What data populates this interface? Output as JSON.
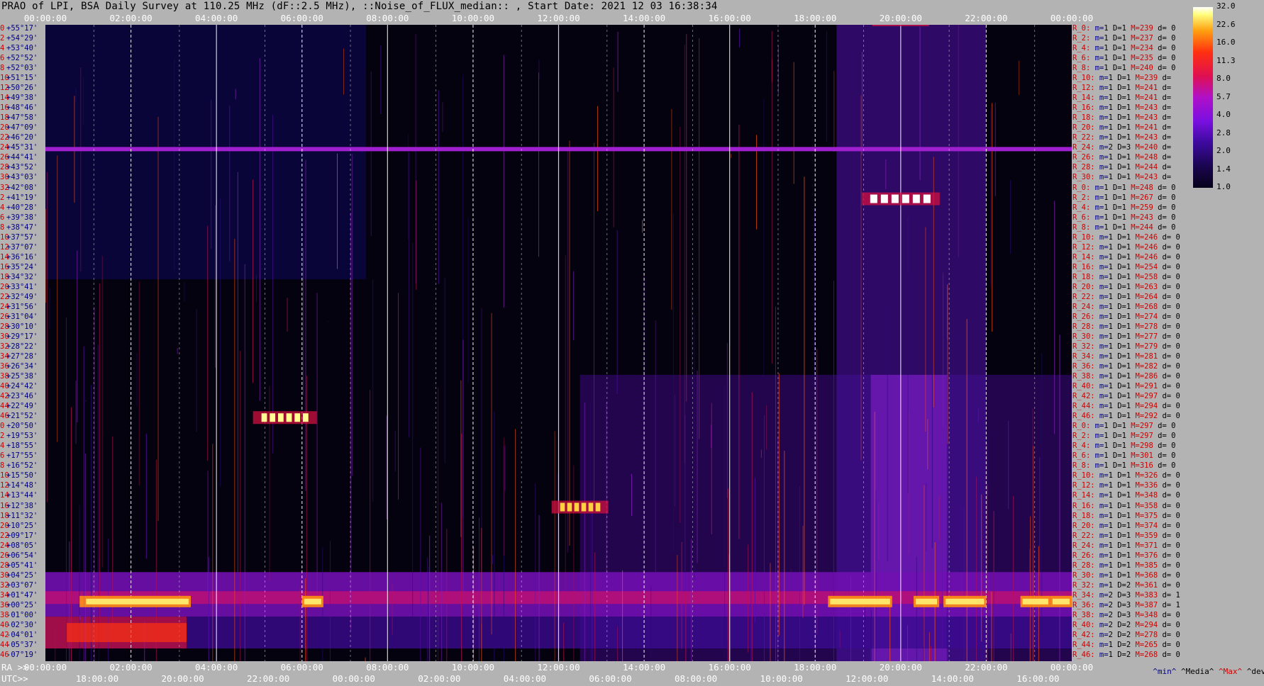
{
  "title": "PRAO of LPI, BSA Daily Survey at 110.25 MHz (dF::2.5 MHz), ::Noise_of_FLUX_median:: , Start Date: 2021 12 03 16:38:34",
  "top_ticks": [
    "00:00:00",
    "02:00:00",
    "04:00:00",
    "06:00:00",
    "08:00:00",
    "10:00:00",
    "12:00:00",
    "14:00:00",
    "16:00:00",
    "18:00:00",
    "20:00:00",
    "22:00:00",
    "00:00:00"
  ],
  "bottom": {
    "ra_label": "RA >>",
    "utc_label": "UTC>>",
    "ra_ticks": [
      "00:00:00",
      "02:00:00",
      "04:00:00",
      "06:00:00",
      "08:00:00",
      "10:00:00",
      "12:00:00",
      "14:00:00",
      "16:00:00",
      "18:00:00",
      "20:00:00",
      "22:00:00",
      "00:00:00"
    ],
    "utc_ticks": [
      "18:00:00",
      "20:00:00",
      "22:00:00",
      "00:00:00",
      "02:00:00",
      "04:00:00",
      "06:00:00",
      "08:00:00",
      "10:00:00",
      "12:00:00",
      "14:00:00",
      "16:00:00"
    ]
  },
  "legend": {
    "min": "^min^",
    "median": "^Media^",
    "max": "^Max^",
    "dev": "^devia"
  },
  "colorbar": {
    "ticks": [
      "32.0",
      "22.6",
      "16.0",
      "11.3",
      "8.0",
      "5.7",
      "4.0",
      "2.8",
      "2.0",
      "1.4",
      "1.0"
    ]
  },
  "colors": {
    "background": "#b3b3b3",
    "plot": "#05020f",
    "red": "#d00000",
    "navy": "#000080"
  },
  "declinations": [
    {
      "n": "0",
      "d": "+55°17'"
    },
    {
      "n": "2",
      "d": "+54°29'"
    },
    {
      "n": "4",
      "d": "+53°40'"
    },
    {
      "n": "6",
      "d": "+52°52'"
    },
    {
      "n": "8",
      "d": "+52°03'"
    },
    {
      "n": "10",
      "d": "+51°15'"
    },
    {
      "n": "12",
      "d": "+50°26'"
    },
    {
      "n": "14",
      "d": "+49°38'"
    },
    {
      "n": "16",
      "d": "+48°46'"
    },
    {
      "n": "18",
      "d": "+47°58'"
    },
    {
      "n": "20",
      "d": "+47°09'"
    },
    {
      "n": "22",
      "d": "+46°20'"
    },
    {
      "n": "24",
      "d": "+45°31'"
    },
    {
      "n": "26",
      "d": "+44°41'"
    },
    {
      "n": "28",
      "d": "+43°52'"
    },
    {
      "n": "30",
      "d": "+43°03'"
    },
    {
      "n": "32",
      "d": "+42°08'"
    },
    {
      "n": "2",
      "d": "+41°19'"
    },
    {
      "n": "4",
      "d": "+40°28'"
    },
    {
      "n": "6",
      "d": "+39°38'"
    },
    {
      "n": "8",
      "d": "+38°47'"
    },
    {
      "n": "10",
      "d": "+37°57'"
    },
    {
      "n": "12",
      "d": "+37°07'"
    },
    {
      "n": "14",
      "d": "+36°16'"
    },
    {
      "n": "16",
      "d": "+35°24'"
    },
    {
      "n": "18",
      "d": "+34°32'"
    },
    {
      "n": "20",
      "d": "+33°41'"
    },
    {
      "n": "22",
      "d": "+32°49'"
    },
    {
      "n": "24",
      "d": "+31°56'"
    },
    {
      "n": "26",
      "d": "+31°04'"
    },
    {
      "n": "28",
      "d": "+30°10'"
    },
    {
      "n": "30",
      "d": "+29°17'"
    },
    {
      "n": "32",
      "d": "+28°22'"
    },
    {
      "n": "34",
      "d": "+27°28'"
    },
    {
      "n": "36",
      "d": "+26°34'"
    },
    {
      "n": "38",
      "d": "+25°38'"
    },
    {
      "n": "40",
      "d": "+24°42'"
    },
    {
      "n": "42",
      "d": "+23°46'"
    },
    {
      "n": "44",
      "d": "+22°49'"
    },
    {
      "n": "46",
      "d": "+21°52'"
    },
    {
      "n": "0",
      "d": "+20°50'"
    },
    {
      "n": "2",
      "d": "+19°53'"
    },
    {
      "n": "4",
      "d": "+18°55'"
    },
    {
      "n": "6",
      "d": "+17°55'"
    },
    {
      "n": "8",
      "d": "+16°52'"
    },
    {
      "n": "10",
      "d": "+15°50'"
    },
    {
      "n": "12",
      "d": "+14°48'"
    },
    {
      "n": "14",
      "d": "+13°44'"
    },
    {
      "n": "16",
      "d": "+12°38'"
    },
    {
      "n": "18",
      "d": "+11°32'"
    },
    {
      "n": "20",
      "d": "+10°25'"
    },
    {
      "n": "22",
      "d": "+09°17'"
    },
    {
      "n": "24",
      "d": "+08°05'"
    },
    {
      "n": "26",
      "d": "+06°54'"
    },
    {
      "n": "28",
      "d": "+05°41'"
    },
    {
      "n": "30",
      "d": "+04°25'"
    },
    {
      "n": "32",
      "d": "+03°07'"
    },
    {
      "n": "34",
      "d": "+01°47'"
    },
    {
      "n": "36",
      "d": "+00°25'"
    },
    {
      "n": "38",
      "d": "-01°00'"
    },
    {
      "n": "40",
      "d": "-02°30'"
    },
    {
      "n": "42",
      "d": "-04°01'"
    },
    {
      "n": "44",
      "d": "-05°37'"
    },
    {
      "n": "46",
      "d": "-07°19'"
    }
  ],
  "right_labels": [
    {
      "ra": "R_0:",
      "m": "1",
      "D": "1",
      "M": "239",
      "d": "0"
    },
    {
      "ra": "R_2:",
      "m": "1",
      "D": "1",
      "M": "237",
      "d": "0"
    },
    {
      "ra": "R_4:",
      "m": "1",
      "D": "1",
      "M": "234",
      "d": "0"
    },
    {
      "ra": "R_6:",
      "m": "1",
      "D": "1",
      "M": "235",
      "d": "0"
    },
    {
      "ra": "R_8:",
      "m": "1",
      "D": "1",
      "M": "240",
      "d": "0"
    },
    {
      "ra": "R_10:",
      "m": "1",
      "D": "1",
      "M": "239",
      "d": ""
    },
    {
      "ra": "R_12:",
      "m": "1",
      "D": "1",
      "M": "241",
      "d": ""
    },
    {
      "ra": "R_14:",
      "m": "1",
      "D": "1",
      "M": "241",
      "d": ""
    },
    {
      "ra": "R_16:",
      "m": "1",
      "D": "1",
      "M": "243",
      "d": ""
    },
    {
      "ra": "R_18:",
      "m": "1",
      "D": "1",
      "M": "243",
      "d": ""
    },
    {
      "ra": "R_20:",
      "m": "1",
      "D": "1",
      "M": "241",
      "d": ""
    },
    {
      "ra": "R_22:",
      "m": "1",
      "D": "1",
      "M": "243",
      "d": ""
    },
    {
      "ra": "R_24:",
      "m": "2",
      "D": "3",
      "M": "240",
      "d": ""
    },
    {
      "ra": "R_26:",
      "m": "1",
      "D": "1",
      "M": "248",
      "d": ""
    },
    {
      "ra": "R_28:",
      "m": "1",
      "D": "1",
      "M": "244",
      "d": ""
    },
    {
      "ra": "R_30:",
      "m": "1",
      "D": "1",
      "M": "243",
      "d": ""
    },
    {
      "ra": "R_0:",
      "m": "1",
      "D": "1",
      "M": "248",
      "d": "0"
    },
    {
      "ra": "R_2:",
      "m": "1",
      "D": "1",
      "M": "267",
      "d": "0"
    },
    {
      "ra": "R_4:",
      "m": "1",
      "D": "1",
      "M": "259",
      "d": "0"
    },
    {
      "ra": "R_6:",
      "m": "1",
      "D": "1",
      "M": "243",
      "d": "0"
    },
    {
      "ra": "R_8:",
      "m": "1",
      "D": "1",
      "M": "244",
      "d": "0"
    },
    {
      "ra": "R_10:",
      "m": "1",
      "D": "1",
      "M": "246",
      "d": "0"
    },
    {
      "ra": "R_12:",
      "m": "1",
      "D": "1",
      "M": "246",
      "d": "0"
    },
    {
      "ra": "R_14:",
      "m": "1",
      "D": "1",
      "M": "246",
      "d": "0"
    },
    {
      "ra": "R_16:",
      "m": "1",
      "D": "1",
      "M": "254",
      "d": "0"
    },
    {
      "ra": "R_18:",
      "m": "1",
      "D": "1",
      "M": "258",
      "d": "0"
    },
    {
      "ra": "R_20:",
      "m": "1",
      "D": "1",
      "M": "263",
      "d": "0"
    },
    {
      "ra": "R_22:",
      "m": "1",
      "D": "1",
      "M": "264",
      "d": "0"
    },
    {
      "ra": "R_24:",
      "m": "1",
      "D": "1",
      "M": "268",
      "d": "0"
    },
    {
      "ra": "R_26:",
      "m": "1",
      "D": "1",
      "M": "274",
      "d": "0"
    },
    {
      "ra": "R_28:",
      "m": "1",
      "D": "1",
      "M": "278",
      "d": "0"
    },
    {
      "ra": "R_30:",
      "m": "1",
      "D": "1",
      "M": "277",
      "d": "0"
    },
    {
      "ra": "R_32:",
      "m": "1",
      "D": "1",
      "M": "279",
      "d": "0"
    },
    {
      "ra": "R_34:",
      "m": "1",
      "D": "1",
      "M": "281",
      "d": "0"
    },
    {
      "ra": "R_36:",
      "m": "1",
      "D": "1",
      "M": "282",
      "d": "0"
    },
    {
      "ra": "R_38:",
      "m": "1",
      "D": "1",
      "M": "286",
      "d": "0"
    },
    {
      "ra": "R_40:",
      "m": "1",
      "D": "1",
      "M": "291",
      "d": "0"
    },
    {
      "ra": "R_42:",
      "m": "1",
      "D": "1",
      "M": "297",
      "d": "0"
    },
    {
      "ra": "R_44:",
      "m": "1",
      "D": "1",
      "M": "294",
      "d": "0"
    },
    {
      "ra": "R_46:",
      "m": "1",
      "D": "1",
      "M": "292",
      "d": "0"
    },
    {
      "ra": "R_0:",
      "m": "1",
      "D": "1",
      "M": "297",
      "d": "0"
    },
    {
      "ra": "R_2:",
      "m": "1",
      "D": "1",
      "M": "297",
      "d": "0"
    },
    {
      "ra": "R_4:",
      "m": "1",
      "D": "1",
      "M": "298",
      "d": "0"
    },
    {
      "ra": "R_6:",
      "m": "1",
      "D": "1",
      "M": "301",
      "d": "0"
    },
    {
      "ra": "R_8:",
      "m": "1",
      "D": "1",
      "M": "316",
      "d": "0"
    },
    {
      "ra": "R_10:",
      "m": "1",
      "D": "1",
      "M": "326",
      "d": "0"
    },
    {
      "ra": "R_12:",
      "m": "1",
      "D": "1",
      "M": "336",
      "d": "0"
    },
    {
      "ra": "R_14:",
      "m": "1",
      "D": "1",
      "M": "348",
      "d": "0"
    },
    {
      "ra": "R_16:",
      "m": "1",
      "D": "1",
      "M": "358",
      "d": "0"
    },
    {
      "ra": "R_18:",
      "m": "1",
      "D": "1",
      "M": "375",
      "d": "0"
    },
    {
      "ra": "R_20:",
      "m": "1",
      "D": "1",
      "M": "374",
      "d": "0"
    },
    {
      "ra": "R_22:",
      "m": "1",
      "D": "1",
      "M": "359",
      "d": "0"
    },
    {
      "ra": "R_24:",
      "m": "1",
      "D": "1",
      "M": "371",
      "d": "0"
    },
    {
      "ra": "R_26:",
      "m": "1",
      "D": "1",
      "M": "376",
      "d": "0"
    },
    {
      "ra": "R_28:",
      "m": "1",
      "D": "1",
      "M": "385",
      "d": "0"
    },
    {
      "ra": "R_30:",
      "m": "1",
      "D": "1",
      "M": "368",
      "d": "0"
    },
    {
      "ra": "R_32:",
      "m": "1",
      "D": "2",
      "M": "361",
      "d": "0"
    },
    {
      "ra": "R_34:",
      "m": "2",
      "D": "3",
      "M": "383",
      "d": "1"
    },
    {
      "ra": "R_36:",
      "m": "2",
      "D": "3",
      "M": "387",
      "d": "1"
    },
    {
      "ra": "R_38:",
      "m": "2",
      "D": "3",
      "M": "348",
      "d": "0"
    },
    {
      "ra": "R_40:",
      "m": "2",
      "D": "2",
      "M": "294",
      "d": "0"
    },
    {
      "ra": "R_42:",
      "m": "2",
      "D": "2",
      "M": "278",
      "d": "0"
    },
    {
      "ra": "R_44:",
      "m": "1",
      "D": "2",
      "M": "265",
      "d": "0"
    },
    {
      "ra": "R_46:",
      "m": "1",
      "D": "2",
      "M": "268",
      "d": "0"
    }
  ],
  "chart_data": {
    "type": "heatmap",
    "title": "PRAO of LPI, BSA Daily Survey at 110.25 MHz (dF::2.5 MHz), ::Noise_of_FLUX_median:: , Start Date: 2021 12 03 16:38:34",
    "x_axis": "RA (hours)",
    "x_range": [
      0,
      24
    ],
    "y_range": [
      "+55°17'",
      "-07°19'"
    ],
    "colorbar_range": [
      1.0,
      32.0
    ],
    "colorbar_scale": "log2",
    "bright_sources": [
      {
        "ra_h": 20.0,
        "dec": "+41°19'",
        "level": 32.0
      },
      {
        "ra_h": 5.6,
        "dec": "+21°52'",
        "level": 22.6
      },
      {
        "ra_h": 12.5,
        "dec": "+12°38'",
        "level": 16.0
      },
      {
        "ra_h": 20.0,
        "dec": "+01°00'",
        "level": 16.0
      }
    ],
    "horizontal_band": {
      "dec": "+45°31'",
      "level": 3.0
    },
    "galactic_plane_ra_h": [
      19.0,
      21.5
    ]
  }
}
